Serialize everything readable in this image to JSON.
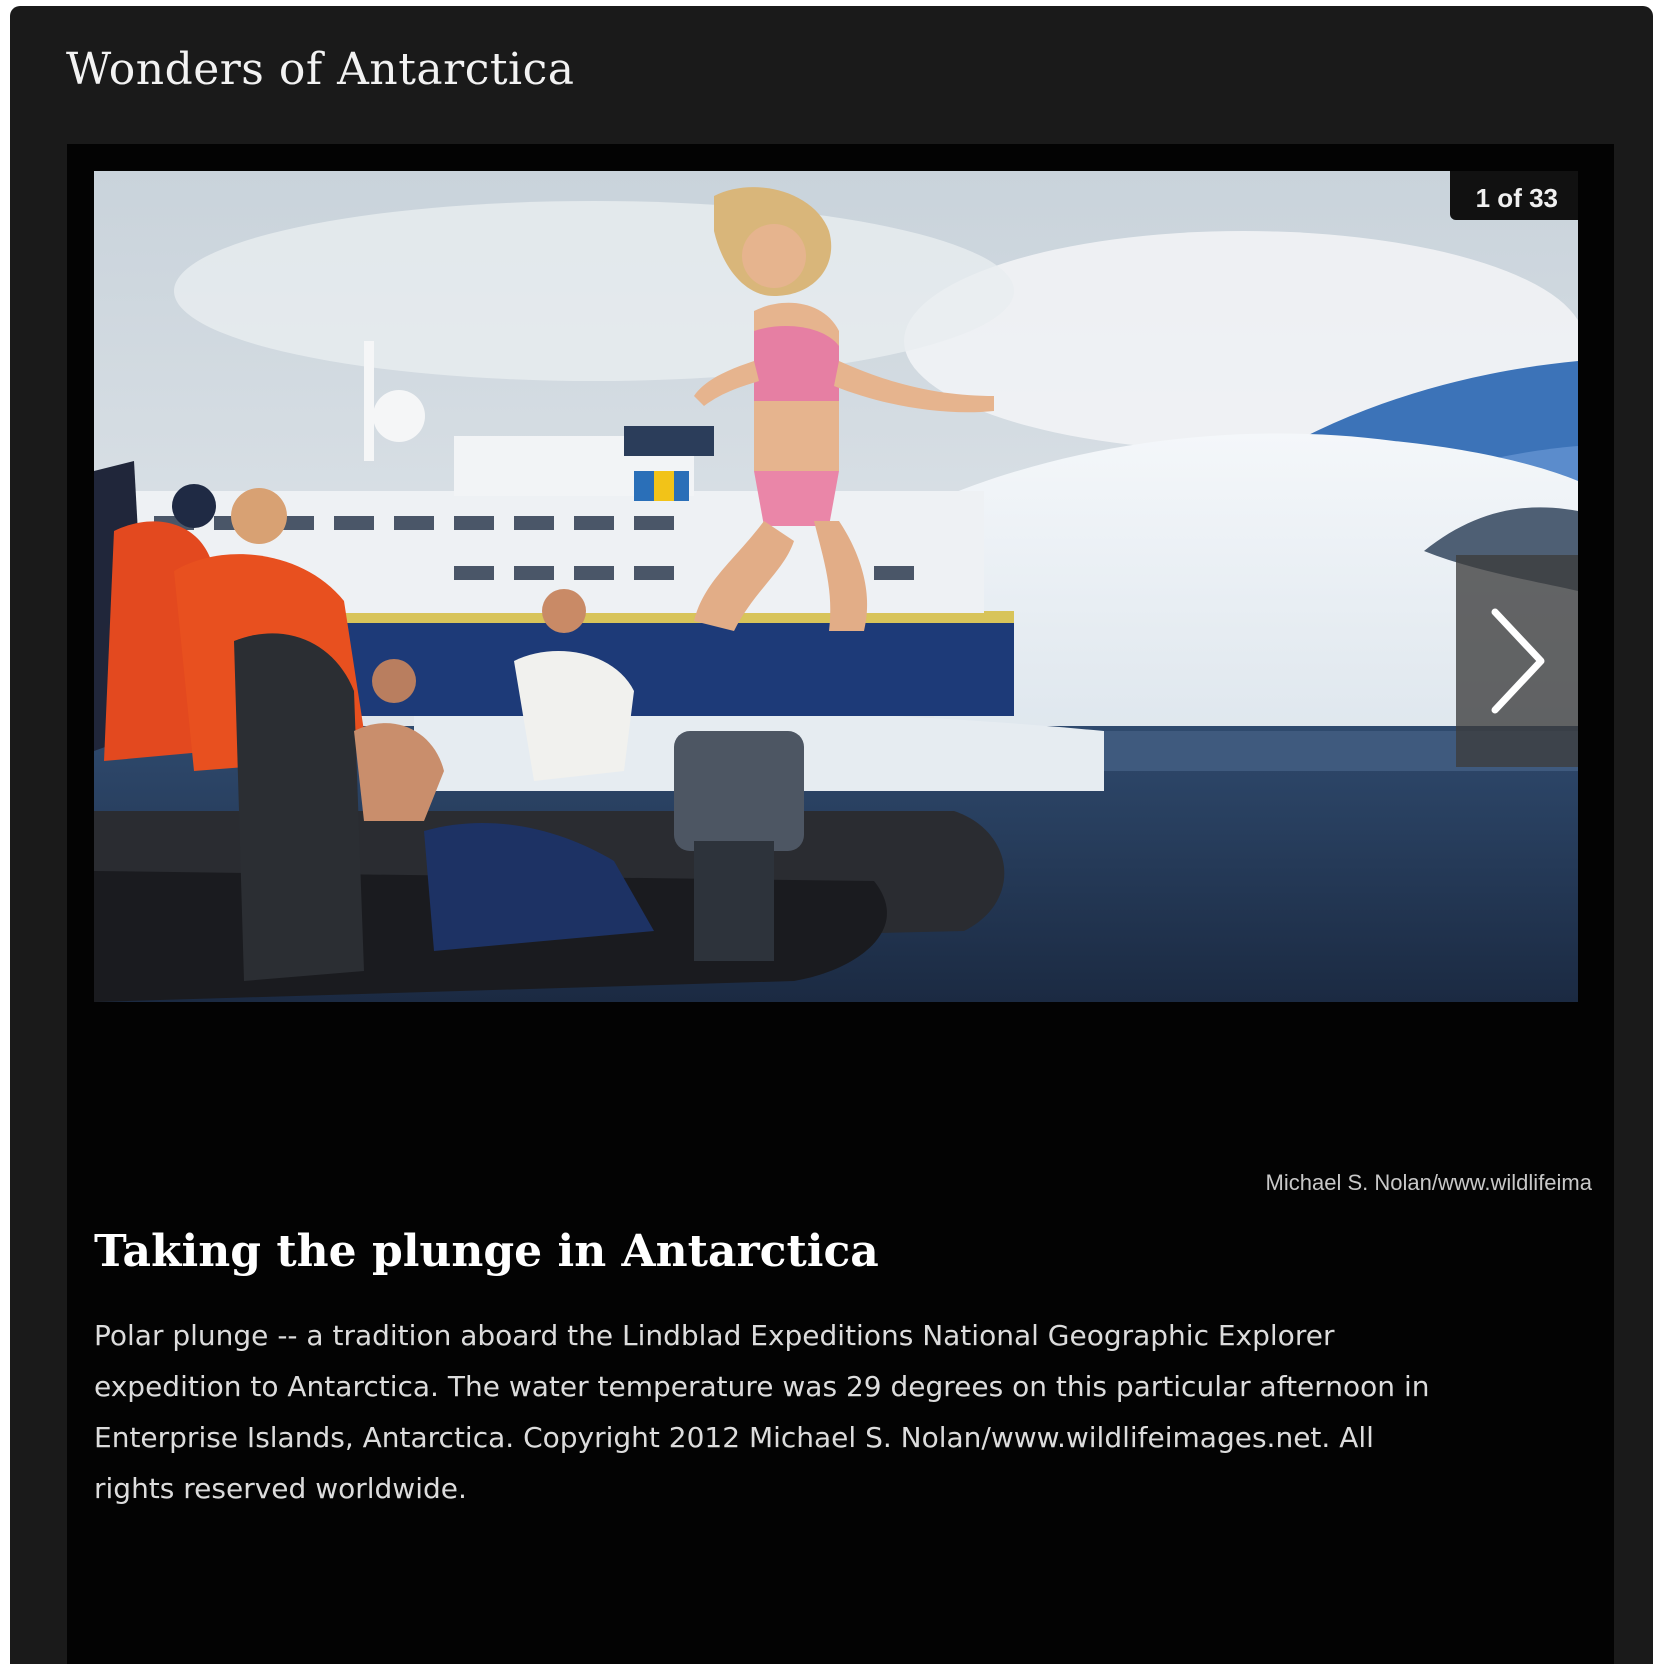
{
  "gallery": {
    "title": "Wonders of Antarctica"
  },
  "slide": {
    "counter": "1 of 33",
    "credit": "Michael S. Nolan/www.wildlifeima",
    "title": "Taking the plunge in Antarctica",
    "caption": "Polar plunge -- a tradition aboard the Lindblad Expeditions National Geographic Explorer expedition to Antarctica. The water temperature was 29 degrees on this particular afternoon in Enterprise Islands, Antarctica. Copyright 2012 Michael S. Nolan/www.wildlifeimages.net. All rights reserved worldwide."
  },
  "icons": {
    "next": "chevron-right-icon"
  },
  "colors": {
    "frame": "#1a1a1a",
    "stage": "#030303",
    "caption_text": "#dcdcdc"
  }
}
